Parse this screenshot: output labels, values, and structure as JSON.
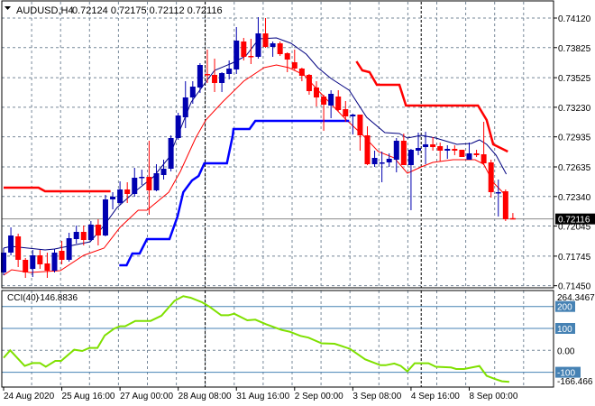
{
  "header": {
    "symbol": "AUDUSD,H4",
    "ohlc": "0.72124 0.72175 0.72112 0.72116"
  },
  "colors": {
    "bull": "#0000b0",
    "bear": "#ff0000",
    "upper_ma": "#000080",
    "lower_ma": "#ff0000",
    "stop_red": "#ff0000",
    "stop_blue": "#0000ff",
    "cci": "#7fe000",
    "level": "#4682b4",
    "grid": "#778899"
  },
  "chart_data": [
    {
      "type": "candlestick",
      "title": "AUDUSD,H4",
      "ylim": [
        0.7145,
        0.7412
      ],
      "price_ticks": [
        "0.74120",
        "0.73825",
        "0.73525",
        "0.73230",
        "0.72935",
        "0.72635",
        "0.72340",
        "0.72045",
        "0.71745",
        "0.71450"
      ],
      "current_price": "0.72116",
      "x_ticks": [
        {
          "index": 0,
          "label": "24 Aug 2020"
        },
        {
          "index": 8,
          "label": "25 Aug 16:00"
        },
        {
          "index": 16,
          "label": "27 Aug 00:00"
        },
        {
          "index": 24,
          "label": "28 Aug 08:00"
        },
        {
          "index": 32,
          "label": "31 Aug 16:00"
        },
        {
          "index": 40,
          "label": "2 Sep 00:00"
        },
        {
          "index": 48,
          "label": "3 Sep 08:00"
        },
        {
          "index": 56,
          "label": "4 Sep 16:00"
        },
        {
          "index": 64,
          "label": "8 Sep 00:00"
        }
      ],
      "candles_ohlc": [
        [
          0.71582,
          0.71825,
          0.71555,
          0.7178
        ],
        [
          0.7178,
          0.72032,
          0.71753,
          0.71951
        ],
        [
          0.71942,
          0.71969,
          0.71636,
          0.71708
        ],
        [
          0.71708,
          0.71726,
          0.71528,
          0.71582
        ],
        [
          0.71618,
          0.71807,
          0.71537,
          0.71753
        ],
        [
          0.71753,
          0.71807,
          0.71618,
          0.71663
        ],
        [
          0.71672,
          0.7178,
          0.71528,
          0.716
        ],
        [
          0.716,
          0.71816,
          0.71582,
          0.7178
        ],
        [
          0.71798,
          0.71897,
          0.71663,
          0.71708
        ],
        [
          0.71708,
          0.71978,
          0.7169,
          0.71924
        ],
        [
          0.71915,
          0.7205,
          0.7187,
          0.71987
        ],
        [
          0.71987,
          0.7205,
          0.71852,
          0.71906
        ],
        [
          0.71906,
          0.72095,
          0.71897,
          0.72059
        ],
        [
          0.72059,
          0.72113,
          0.71852,
          0.71951
        ],
        [
          0.71951,
          0.72356,
          0.71942,
          0.72311
        ],
        [
          0.72311,
          0.72383,
          0.72212,
          0.72338
        ],
        [
          0.72275,
          0.72491,
          0.72257,
          0.7241
        ],
        [
          0.7241,
          0.72482,
          0.72275,
          0.72365
        ],
        [
          0.72365,
          0.72626,
          0.72338,
          0.72527
        ],
        [
          0.72527,
          0.72608,
          0.72455,
          0.72536
        ],
        [
          0.72536,
          0.72896,
          0.72158,
          0.72401
        ],
        [
          0.72401,
          0.72662,
          0.72392,
          0.72572
        ],
        [
          0.72554,
          0.72707,
          0.72509,
          0.72617
        ],
        [
          0.72617,
          0.7295,
          0.7259,
          0.72923
        ],
        [
          0.72923,
          0.73175,
          0.72905,
          0.73148
        ],
        [
          0.7313,
          0.7349,
          0.73022,
          0.73328
        ],
        [
          0.73328,
          0.7349,
          0.73265,
          0.73436
        ],
        [
          0.73427,
          0.7367,
          0.73373,
          0.73652
        ],
        [
          0.73562,
          0.73805,
          0.73472,
          0.73553
        ],
        [
          0.73553,
          0.73715,
          0.73382,
          0.73472
        ],
        [
          0.73472,
          0.7358,
          0.73382,
          0.73571
        ],
        [
          0.73562,
          0.73697,
          0.73508,
          0.73616
        ],
        [
          0.73607,
          0.7403,
          0.73562,
          0.73895
        ],
        [
          0.73886,
          0.73922,
          0.73697,
          0.73733
        ],
        [
          0.73742,
          0.73913,
          0.73661,
          0.73733
        ],
        [
          0.73733,
          0.74129,
          0.73715,
          0.73967
        ],
        [
          0.73967,
          0.7412,
          0.73823,
          0.73832
        ],
        [
          0.73832,
          0.73886,
          0.73733,
          0.73868
        ],
        [
          0.73868,
          0.73886,
          0.73742,
          0.7376
        ],
        [
          0.73769,
          0.73778,
          0.7358,
          0.73706
        ],
        [
          0.73679,
          0.73805,
          0.73598,
          0.73616
        ],
        [
          0.73616,
          0.73625,
          0.7349,
          0.73544
        ],
        [
          0.73553,
          0.73562,
          0.73355,
          0.73391
        ],
        [
          0.73427,
          0.7349,
          0.73238,
          0.73328
        ],
        [
          0.73337,
          0.73355,
          0.72995,
          0.73256
        ],
        [
          0.73247,
          0.734,
          0.73121,
          0.73364
        ],
        [
          0.73337,
          0.734,
          0.73193,
          0.73202
        ],
        [
          0.73211,
          0.73292,
          0.73085,
          0.73139
        ],
        [
          0.73139,
          0.73166,
          0.72959,
          0.73157
        ],
        [
          0.73157,
          0.73157,
          0.72797,
          0.7295
        ],
        [
          0.7295,
          0.7304,
          0.72653,
          0.72662
        ],
        [
          0.72662,
          0.72797,
          0.72635,
          0.72725
        ],
        [
          0.72671,
          0.72788,
          0.72482,
          0.7268
        ],
        [
          0.7268,
          0.7277,
          0.72635,
          0.72716
        ],
        [
          0.72707,
          0.72923,
          0.72581,
          0.72896
        ],
        [
          0.72896,
          0.72968,
          0.72653,
          0.72653
        ],
        [
          0.72653,
          0.72815,
          0.72203,
          0.72806
        ],
        [
          0.72797,
          0.72977,
          0.72752,
          0.72824
        ],
        [
          0.72833,
          0.72986,
          0.72662,
          0.7286
        ],
        [
          0.7286,
          0.72932,
          0.72797,
          0.72833
        ],
        [
          0.72842,
          0.72878,
          0.72689,
          0.72797
        ],
        [
          0.72797,
          0.72851,
          0.72716,
          0.72815
        ],
        [
          0.72815,
          0.72851,
          0.72752,
          0.72797
        ],
        [
          0.72806,
          0.72806,
          0.72734,
          0.72734
        ],
        [
          0.72707,
          0.72878,
          0.72707,
          0.7277
        ],
        [
          0.7277,
          0.72806,
          0.72734,
          0.72752
        ],
        [
          0.72761,
          0.73085,
          0.72653,
          0.72671
        ],
        [
          0.7268,
          0.72707,
          0.72329,
          0.72383
        ],
        [
          0.72374,
          0.72509,
          0.7214,
          0.72383
        ],
        [
          0.72392,
          0.7241,
          0.72095,
          0.72113
        ],
        [
          0.72124,
          0.72175,
          0.72112,
          0.72116
        ]
      ],
      "overlays": [
        {
          "name": "upper-ma",
          "color_key": "upper_ma",
          "width": 1,
          "points": [
            [
              0,
              0.71825
            ],
            [
              1,
              0.71843
            ],
            [
              5.7,
              0.71807
            ],
            [
              7,
              0.71816
            ],
            [
              11.9,
              0.71888
            ],
            [
              13.8,
              0.7205
            ],
            [
              15.6,
              0.7223
            ],
            [
              18.1,
              0.72392
            ],
            [
              20.6,
              0.72536
            ],
            [
              22.7,
              0.72725
            ],
            [
              24.3,
              0.73013
            ],
            [
              25.8,
              0.73283
            ],
            [
              27.6,
              0.73463
            ],
            [
              29,
              0.73598
            ],
            [
              31.4,
              0.7367
            ],
            [
              33.3,
              0.73742
            ],
            [
              35.1,
              0.73913
            ],
            [
              37.5,
              0.73922
            ],
            [
              39.5,
              0.73868
            ],
            [
              41.6,
              0.7376
            ],
            [
              43.2,
              0.73625
            ],
            [
              45,
              0.73517
            ],
            [
              47.5,
              0.734
            ],
            [
              49.9,
              0.7313
            ],
            [
              52.4,
              0.72977
            ],
            [
              54.4,
              0.72968
            ],
            [
              55.5,
              0.72923
            ],
            [
              57.4,
              0.7295
            ],
            [
              59.4,
              0.72923
            ],
            [
              62.3,
              0.7286
            ],
            [
              64.3,
              0.72869
            ],
            [
              65.4,
              0.72905
            ],
            [
              66.4,
              0.7286
            ],
            [
              67.7,
              0.72752
            ],
            [
              69.1,
              0.72563
            ]
          ]
        },
        {
          "name": "lower-ma",
          "color_key": "lower_ma",
          "width": 1,
          "points": [
            [
              0,
              0.71555
            ],
            [
              1.1,
              0.71609
            ],
            [
              3.6,
              0.71582
            ],
            [
              7.8,
              0.716
            ],
            [
              11,
              0.71753
            ],
            [
              13.8,
              0.71825
            ],
            [
              16,
              0.72032
            ],
            [
              18.5,
              0.72203
            ],
            [
              19.7,
              0.72203
            ],
            [
              22.7,
              0.72383
            ],
            [
              24.3,
              0.7259
            ],
            [
              26.4,
              0.72923
            ],
            [
              27.8,
              0.73103
            ],
            [
              30.1,
              0.73283
            ],
            [
              33,
              0.7349
            ],
            [
              35.8,
              0.73625
            ],
            [
              37.5,
              0.73652
            ],
            [
              39.2,
              0.73625
            ],
            [
              41.3,
              0.73553
            ],
            [
              43.2,
              0.734
            ],
            [
              47,
              0.73112
            ],
            [
              49.4,
              0.7295
            ],
            [
              51.5,
              0.72788
            ],
            [
              53.7,
              0.72725
            ],
            [
              55.5,
              0.72572
            ],
            [
              57.4,
              0.72635
            ],
            [
              59,
              0.7268
            ],
            [
              61.8,
              0.72707
            ],
            [
              64.8,
              0.72707
            ],
            [
              66,
              0.72662
            ],
            [
              67.3,
              0.7248
            ],
            [
              69.3,
              0.72329
            ]
          ]
        },
        {
          "name": "red-stop-line-1",
          "color_key": "stop_red",
          "width": 2.5,
          "points": [
            [
              0,
              0.72428
            ],
            [
              4.8,
              0.72428
            ],
            [
              5.7,
              0.72392
            ],
            [
              14.7,
              0.72392
            ]
          ]
        },
        {
          "name": "red-stop-line-2",
          "color_key": "stop_red",
          "width": 2.5,
          "points": [
            [
              48.5,
              0.73688
            ],
            [
              49.3,
              0.73598
            ],
            [
              50.3,
              0.7358
            ],
            [
              51.3,
              0.73454
            ],
            [
              54.4,
              0.73454
            ],
            [
              55.3,
              0.73247
            ],
            [
              65.2,
              0.73247
            ],
            [
              66.4,
              0.73103
            ],
            [
              67.3,
              0.7286
            ],
            [
              69.3,
              0.72788
            ]
          ]
        },
        {
          "name": "blue-stop-line",
          "color_key": "stop_blue",
          "width": 2.5,
          "points": [
            [
              15.9,
              0.71654
            ],
            [
              16.9,
              0.71654
            ],
            [
              17.7,
              0.71771
            ],
            [
              18.7,
              0.71771
            ],
            [
              19.7,
              0.71915
            ],
            [
              22.8,
              0.71915
            ],
            [
              23.9,
              0.7214
            ],
            [
              24.7,
              0.72383
            ],
            [
              25.9,
              0.725
            ],
            [
              26.8,
              0.72545
            ],
            [
              27.6,
              0.72671
            ],
            [
              30.7,
              0.72671
            ],
            [
              31.5,
              0.7295
            ],
            [
              31.6,
              0.73013
            ],
            [
              33.8,
              0.73013
            ],
            [
              34.6,
              0.73094
            ],
            [
              47.5,
              0.73094
            ]
          ]
        }
      ]
    },
    {
      "type": "line",
      "title": "CCI(40)",
      "current_value": "-146.8836",
      "ylim": [
        -166.466,
        264.3467
      ],
      "max_label": "264.3467",
      "min_label": "-166.466",
      "levels": [
        {
          "value": 200,
          "label": "200",
          "boxed": true
        },
        {
          "value": 100,
          "label": "100",
          "boxed": true
        },
        {
          "value": 0,
          "label": "0.00",
          "boxed": false
        },
        {
          "value": -100,
          "label": "-100",
          "boxed": true
        }
      ],
      "points": [
        [
          0,
          -34
        ],
        [
          0.9,
          0
        ],
        [
          2.9,
          -71
        ],
        [
          4,
          -58
        ],
        [
          5,
          -58
        ],
        [
          5.8,
          -75
        ],
        [
          7.1,
          -48
        ],
        [
          7.9,
          -48
        ],
        [
          9.7,
          3
        ],
        [
          10.8,
          -3
        ],
        [
          11.8,
          11
        ],
        [
          12.9,
          11
        ],
        [
          13.9,
          68
        ],
        [
          15.2,
          99
        ],
        [
          16,
          110
        ],
        [
          16.7,
          110
        ],
        [
          18.1,
          134
        ],
        [
          20.2,
          134
        ],
        [
          21.7,
          158
        ],
        [
          23.5,
          226
        ],
        [
          24.7,
          247
        ],
        [
          25.7,
          240
        ],
        [
          27.3,
          219
        ],
        [
          28.3,
          199
        ],
        [
          29.9,
          160
        ],
        [
          30.9,
          160
        ],
        [
          31.7,
          167
        ],
        [
          33.5,
          137
        ],
        [
          34.6,
          140
        ],
        [
          36.1,
          119
        ],
        [
          38.2,
          93
        ],
        [
          39.3,
          85
        ],
        [
          40.8,
          66
        ],
        [
          41.9,
          58
        ],
        [
          43.7,
          32
        ],
        [
          45.5,
          30
        ],
        [
          47.6,
          7
        ],
        [
          49.7,
          -41
        ],
        [
          51.8,
          -68
        ],
        [
          52.5,
          -68
        ],
        [
          53.7,
          -60
        ],
        [
          54.6,
          -71
        ],
        [
          55.5,
          -96
        ],
        [
          56.5,
          -59
        ],
        [
          58.4,
          -59
        ],
        [
          59.4,
          -75
        ],
        [
          61.5,
          -78
        ],
        [
          62.2,
          -85
        ],
        [
          63.3,
          -85
        ],
        [
          65.4,
          -71
        ],
        [
          66.4,
          -116
        ],
        [
          67.5,
          -130
        ],
        [
          68.5,
          -141
        ],
        [
          69.5,
          -144
        ]
      ]
    }
  ]
}
